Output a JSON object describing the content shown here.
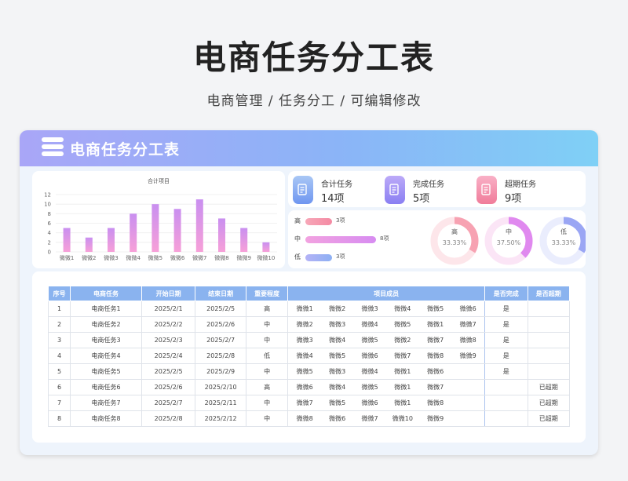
{
  "page": {
    "title": "电商任务分工表",
    "subtitle": "电商管理 /  任务分工 /  可编辑修改"
  },
  "card": {
    "title": "电商任务分工表"
  },
  "chart_data": {
    "type": "bar",
    "title": "合计项目",
    "categories": [
      "微微1",
      "微微2",
      "微微3",
      "微微4",
      "微微5",
      "微微6",
      "微微7",
      "微微8",
      "微微9",
      "微微10"
    ],
    "values": [
      5,
      3,
      5,
      8,
      10,
      9,
      11,
      7,
      5,
      2
    ],
    "ylim": [
      0,
      12
    ],
    "yticks": [
      0,
      2,
      4,
      6,
      8,
      10,
      12
    ],
    "grid": true,
    "bar_gradient": [
      "#f7a0d8",
      "#c98ff0"
    ]
  },
  "stats": [
    {
      "label": "合计任务",
      "value": "14项",
      "icon": "document-icon",
      "color": [
        "#a9c7f5",
        "#6f96f0"
      ]
    },
    {
      "label": "完成任务",
      "value": "5项",
      "icon": "document-check-icon",
      "color": [
        "#bcaaf8",
        "#8a7ff2"
      ]
    },
    {
      "label": "超期任务",
      "value": "9项",
      "icon": "document-alert-icon",
      "color": [
        "#f9b0c6",
        "#f07c9a"
      ]
    }
  ],
  "levels": [
    {
      "key": "高",
      "count": 3,
      "text": "3项",
      "colors": [
        "#f7a7b8",
        "#f48aa3"
      ]
    },
    {
      "key": "中",
      "count": 8,
      "text": "8项",
      "colors": [
        "#f2a2e0",
        "#d78cf1"
      ]
    },
    {
      "key": "低",
      "count": 3,
      "text": "3项",
      "colors": [
        "#b4b2f6",
        "#8db0f3"
      ]
    }
  ],
  "donuts": [
    {
      "label": "高",
      "percent_text": "33.33%",
      "fraction": 0.3333,
      "color": "#f7a2b2",
      "track": "#fde6ea"
    },
    {
      "label": "中",
      "percent_text": "37.50%",
      "fraction": 0.375,
      "color": "#e089ef",
      "track": "#fbe5f6"
    },
    {
      "label": "低",
      "percent_text": "33.33%",
      "fraction": 0.3333,
      "color": "#9aa6f4",
      "track": "#eaedfd"
    }
  ],
  "table": {
    "headers": [
      "序号",
      "电商任务",
      "开始日期",
      "结束日期",
      "重要程度",
      "项目成员",
      "是否完成",
      "是否超期"
    ],
    "rows": [
      {
        "no": "1",
        "task": "电商任务1",
        "start": "2025/2/1",
        "end": "2025/2/5",
        "level": "高",
        "members": [
          "微微1",
          "微微2",
          "微微3",
          "微微4",
          "微微5",
          "微微6"
        ],
        "done": "是",
        "overdue": ""
      },
      {
        "no": "2",
        "task": "电商任务2",
        "start": "2025/2/2",
        "end": "2025/2/6",
        "level": "中",
        "members": [
          "微微2",
          "微微3",
          "微微4",
          "微微5",
          "微微1",
          "微微7"
        ],
        "done": "是",
        "overdue": ""
      },
      {
        "no": "3",
        "task": "电商任务3",
        "start": "2025/2/3",
        "end": "2025/2/7",
        "level": "中",
        "members": [
          "微微3",
          "微微4",
          "微微5",
          "微微2",
          "微微7",
          "微微8"
        ],
        "done": "是",
        "overdue": ""
      },
      {
        "no": "4",
        "task": "电商任务4",
        "start": "2025/2/4",
        "end": "2025/2/8",
        "level": "低",
        "members": [
          "微微4",
          "微微5",
          "微微6",
          "微微7",
          "微微8",
          "微微9"
        ],
        "done": "是",
        "overdue": ""
      },
      {
        "no": "5",
        "task": "电商任务5",
        "start": "2025/2/5",
        "end": "2025/2/9",
        "level": "中",
        "members": [
          "微微5",
          "微微3",
          "微微4",
          "微微1",
          "微微6",
          ""
        ],
        "done": "是",
        "overdue": ""
      },
      {
        "no": "6",
        "task": "电商任务6",
        "start": "2025/2/6",
        "end": "2025/2/10",
        "level": "高",
        "members": [
          "微微6",
          "微微4",
          "微微5",
          "微微1",
          "微微7",
          ""
        ],
        "done": "",
        "overdue": "已超期"
      },
      {
        "no": "7",
        "task": "电商任务7",
        "start": "2025/2/7",
        "end": "2025/2/11",
        "level": "中",
        "members": [
          "微微7",
          "微微5",
          "微微6",
          "微微1",
          "微微8",
          ""
        ],
        "done": "",
        "overdue": "已超期"
      },
      {
        "no": "8",
        "task": "电商任务8",
        "start": "2025/2/8",
        "end": "2025/2/12",
        "level": "中",
        "members": [
          "微微8",
          "微微6",
          "微微7",
          "微微10",
          "微微9",
          ""
        ],
        "done": "",
        "overdue": "已超期"
      }
    ]
  }
}
